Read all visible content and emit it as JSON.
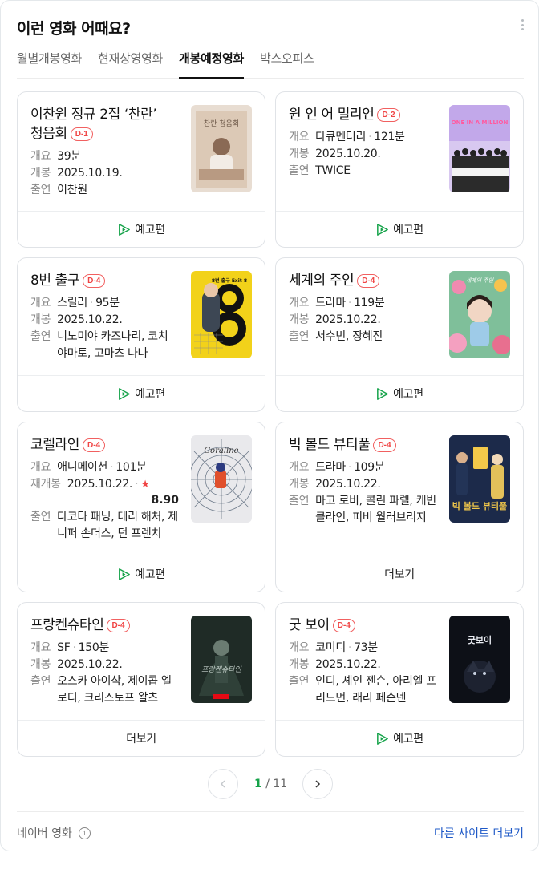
{
  "header": {
    "title": "이런 영화 어때요?"
  },
  "tabs": [
    {
      "label": "월별개봉영화"
    },
    {
      "label": "현재상영영화"
    },
    {
      "label": "개봉예정영화"
    },
    {
      "label": "박스오피스"
    }
  ],
  "colors": {
    "accent": "#16a34a",
    "dday": "#f04545",
    "link": "#1d58c7"
  },
  "cards": [
    {
      "title": "이찬원 정규 2집 ‘찬란’ 청음회",
      "dday": "D-1",
      "rows": [
        {
          "label": "개요",
          "value": "39분"
        },
        {
          "label": "개봉",
          "value": "2025.10.19."
        },
        {
          "label": "출연",
          "value": "이찬원"
        }
      ],
      "poster_text": "찬란 청음회",
      "footer": "예고편"
    },
    {
      "title": "원 인 어 밀리언",
      "dday": "D-2",
      "rows": [
        {
          "label": "개요",
          "genre": "다큐멘터리",
          "runtime": "121분"
        },
        {
          "label": "개봉",
          "value": "2025.10.20."
        },
        {
          "label": "출연",
          "value": "TWICE"
        }
      ],
      "poster_text": "ONE IN A MILLION",
      "footer": "예고편"
    },
    {
      "title": "8번 출구",
      "dday": "D-4",
      "rows": [
        {
          "label": "개요",
          "genre": "스릴러",
          "runtime": "95분"
        },
        {
          "label": "개봉",
          "value": "2025.10.22."
        },
        {
          "label": "출연",
          "value": "니노미야 카즈나리, 코치 야마토, 고마츠 나나"
        }
      ],
      "poster_text": "8번 출구 Exit 8",
      "footer": "예고편"
    },
    {
      "title": "세계의 주인",
      "dday": "D-4",
      "rows": [
        {
          "label": "개요",
          "genre": "드라마",
          "runtime": "119분"
        },
        {
          "label": "개봉",
          "value": "2025.10.22."
        },
        {
          "label": "출연",
          "value": "서수빈, 장혜진"
        }
      ],
      "poster_text": "세계의 주인",
      "footer": "예고편"
    },
    {
      "title": "코렐라인",
      "dday": "D-4",
      "rows": [
        {
          "label": "개요",
          "genre": "애니메이션",
          "runtime": "101분"
        },
        {
          "label": "재개봉",
          "value": "2025.10.22.",
          "rating": "8.90"
        },
        {
          "label": "출연",
          "value": "다코타 패닝, 테리 해처, 제니퍼 손더스, 던 프렌치"
        }
      ],
      "poster_text": "Coraline",
      "footer": "예고편"
    },
    {
      "title": "빅 볼드 뷰티풀",
      "dday": "D-4",
      "rows": [
        {
          "label": "개요",
          "genre": "드라마",
          "runtime": "109분"
        },
        {
          "label": "개봉",
          "value": "2025.10.22."
        },
        {
          "label": "출연",
          "value": "마고 로비, 콜린 파렐, 케빈 클라인, 피비 월러브리지"
        }
      ],
      "poster_text": "빅 볼드 뷰티풀",
      "footer": "더보기"
    },
    {
      "title": "프랑켄슈타인",
      "dday": "D-4",
      "rows": [
        {
          "label": "개요",
          "genre": "SF",
          "runtime": "150분"
        },
        {
          "label": "개봉",
          "value": "2025.10.22."
        },
        {
          "label": "출연",
          "value": "오스카 아이삭, 제이콥 엘로디, 크리스토프 왈츠"
        }
      ],
      "poster_text": "프랑켄슈타인",
      "footer": "더보기"
    },
    {
      "title": "굿 보이",
      "dday": "D-4",
      "rows": [
        {
          "label": "개요",
          "genre": "코미디",
          "runtime": "73분"
        },
        {
          "label": "개봉",
          "value": "2025.10.22."
        },
        {
          "label": "출연",
          "value": "인디, 셰인 젠슨, 아리엘 프리드먼, 래리 페슨덴"
        }
      ],
      "poster_text": "굿보이",
      "footer": "예고편"
    }
  ],
  "pagination": {
    "current": "1",
    "total": "/ 11"
  },
  "footer": {
    "source": "네이버 영화",
    "more_link": "다른 사이트 더보기"
  }
}
